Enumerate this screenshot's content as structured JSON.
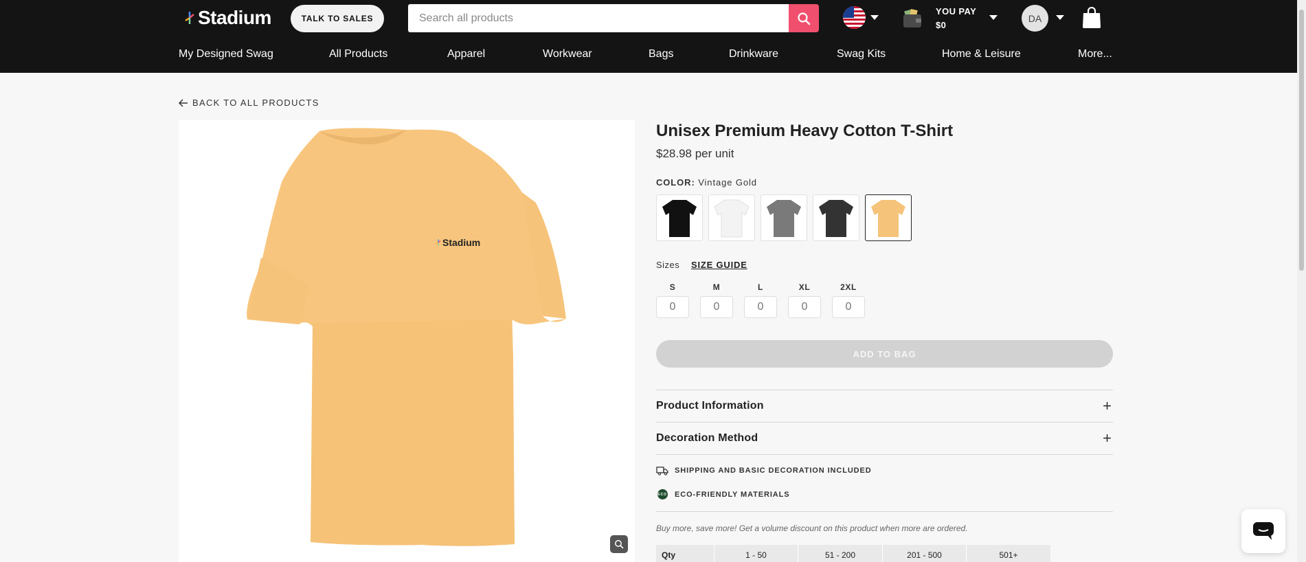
{
  "header": {
    "brand": "Stadium",
    "talk_to_sales": "TALK TO SALES",
    "search": {
      "placeholder": "Search all products",
      "value": ""
    },
    "you_pay_label": "YOU PAY",
    "you_pay_amount": "$0",
    "avatar_initials": "DA",
    "colors": {
      "bar_bg": "#141414",
      "search_button": "#f0506e"
    }
  },
  "nav": {
    "items": [
      "My Designed Swag",
      "All Products",
      "Apparel",
      "Workwear",
      "Bags",
      "Drinkware",
      "Swag Kits",
      "Home & Leisure",
      "More..."
    ]
  },
  "breadcrumb": {
    "back_label": "BACK TO ALL PRODUCTS"
  },
  "product": {
    "title": "Unisex Premium Heavy Cotton T-Shirt",
    "price": "$28.98 per unit",
    "image_logo_text": "Stadium",
    "color_label": "COLOR:",
    "selected_color": "Vintage Gold",
    "swatches": [
      {
        "icon": "tshirt-black",
        "color": "#111111"
      },
      {
        "icon": "tshirt-white",
        "color": "#f5f5f5"
      },
      {
        "icon": "tshirt-gray",
        "color": "#7a7a7a"
      },
      {
        "icon": "tshirt-charcoal",
        "color": "#333333"
      },
      {
        "icon": "tshirt-gold",
        "color": "#f5c37a"
      }
    ],
    "sizes_label": "Sizes",
    "size_guide_label": "SIZE GUIDE",
    "sizes": [
      {
        "label": "S",
        "value": "0"
      },
      {
        "label": "M",
        "value": "0"
      },
      {
        "label": "L",
        "value": "0"
      },
      {
        "label": "XL",
        "value": "0"
      },
      {
        "label": "2XL",
        "value": "0"
      }
    ],
    "add_to_bag": "ADD TO BAG",
    "accordions": [
      "Product Information",
      "Decoration Method"
    ],
    "features": [
      "SHIPPING AND BASIC DECORATION INCLUDED",
      "ECO-FRIENDLY MATERIALS"
    ],
    "eco_badge": "ECO",
    "volume_note": "Buy more, save more! Get a volume discount on this product when more are ordered.",
    "qty_table": {
      "header": "Qty",
      "tiers": [
        "1 - 50",
        "51 - 200",
        "201 - 500",
        "501+"
      ]
    }
  }
}
